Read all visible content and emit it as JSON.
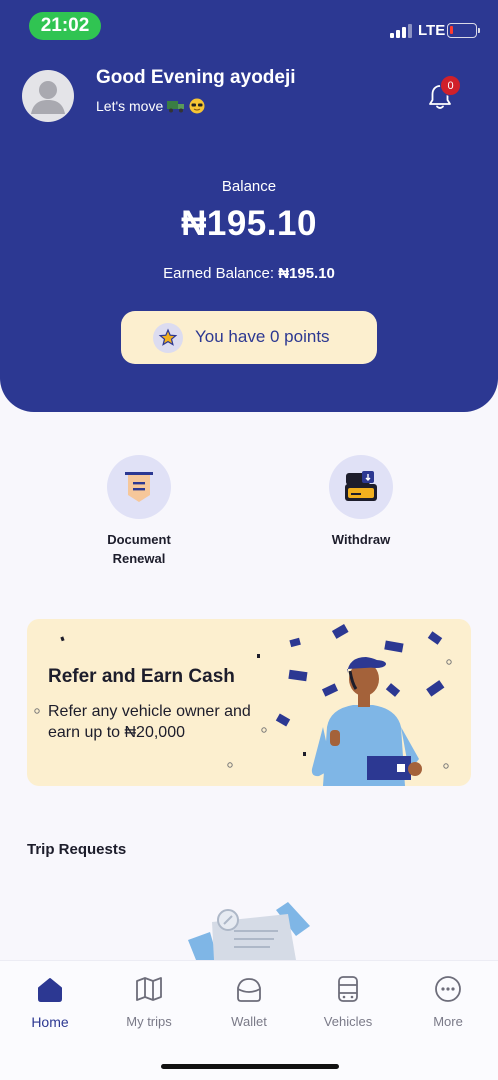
{
  "status_bar": {
    "time": "21:02",
    "network": "LTE"
  },
  "header": {
    "greeting": "Good Evening ayodeji",
    "tagline": "Let's move",
    "tagline_emojis": [
      "truck-emoji",
      "sunglasses-emoji"
    ],
    "notification_count": "0",
    "balance_label": "Balance",
    "balance_value": "₦195.10",
    "earned_label": "Earned Balance:",
    "earned_value": "₦195.10",
    "points_text": "You have 0 points"
  },
  "actions": [
    {
      "label_line1": "Document",
      "label_line2": "Renewal",
      "icon": "document-icon"
    },
    {
      "label_line1": "Withdraw",
      "label_line2": "",
      "icon": "wallet-card-icon"
    }
  ],
  "promo": {
    "title": "Refer and Earn Cash",
    "subtitle": "Refer any vehicle owner and earn up to ₦20,000"
  },
  "trip_requests": {
    "title": "Trip Requests"
  },
  "tabbar": [
    {
      "label": "Home",
      "icon": "home-icon",
      "active": true
    },
    {
      "label": "My trips",
      "icon": "map-icon",
      "active": false
    },
    {
      "label": "Wallet",
      "icon": "wallet-icon",
      "active": false
    },
    {
      "label": "Vehicles",
      "icon": "vehicle-icon",
      "active": false
    },
    {
      "label": "More",
      "icon": "more-icon",
      "active": false
    }
  ],
  "colors": {
    "primary": "#2c3892",
    "points_bg": "#fcefcf",
    "status_green": "#30c452",
    "badge_red": "#d0202a"
  }
}
